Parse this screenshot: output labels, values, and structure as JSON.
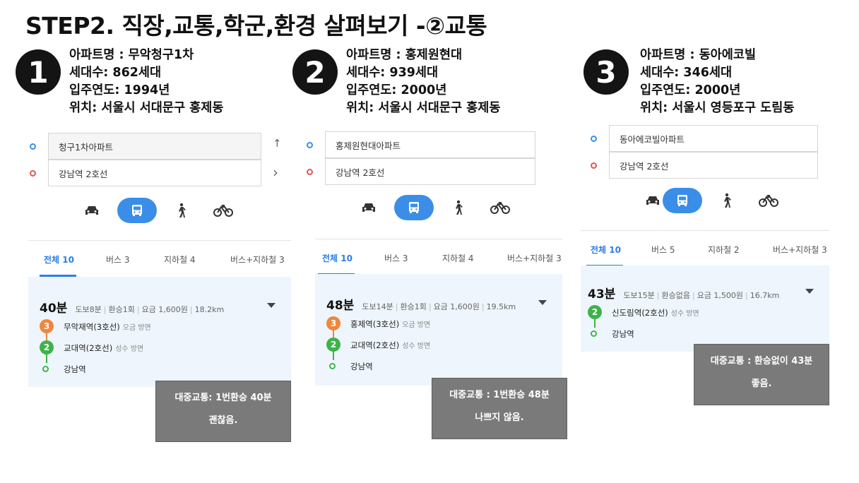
{
  "title": "STEP2. 직장,교통,학군,환경 살펴보기 -②교통",
  "icons": {
    "car": "car-icon",
    "bus": "bus-icon",
    "walk": "walk-icon",
    "bike": "bicycle-icon"
  },
  "colors": {
    "accent": "#3b8ee8",
    "line2": "#3db34a",
    "line3": "#f0873c",
    "note_bg": "#7a7a7a"
  },
  "cards": [
    {
      "number": "1",
      "info": [
        "아파트명 : 무악청구1차",
        "세대수: 862세대",
        "입주연도: 1994년",
        "위치: 서울시 서대문구 홍제동"
      ],
      "start": "청구1차아파트",
      "end": "강남역 2호선",
      "side_top": "↑",
      "side_bottom": "›",
      "tabs": [
        "전체 10",
        "버스 3",
        "지하철 4",
        "버스+지하철 3"
      ],
      "time": "40분",
      "meta": [
        "도보8분",
        "환승1회",
        "요금 1,600원",
        "18.2km"
      ],
      "stops": [
        {
          "line": "3",
          "name": "무악재역(3호선)",
          "dir": "오금 방면"
        },
        {
          "line": "2",
          "name": "교대역(2호선)",
          "dir": "성수 방면"
        }
      ],
      "destination": "강남역",
      "note": [
        "대중교통: 1번환승 40분",
        "괜찮음."
      ]
    },
    {
      "number": "2",
      "info": [
        "아파트명 : 홍제원현대",
        "세대수: 939세대",
        "입주연도: 2000년",
        "위치: 서울시 서대문구 홍제동"
      ],
      "start": "홍제원현대아파트",
      "end": "강남역 2호선",
      "tabs": [
        "전체 10",
        "버스 3",
        "지하철 4",
        "버스+지하철 3"
      ],
      "time": "48분",
      "meta": [
        "도보14분",
        "환승1회",
        "요금 1,600원",
        "19.5km"
      ],
      "stops": [
        {
          "line": "3",
          "name": "홍제역(3호선)",
          "dir": "오금 방면"
        },
        {
          "line": "2",
          "name": "교대역(2호선)",
          "dir": "성수 방면"
        }
      ],
      "destination": "강남역",
      "note": [
        "대중교통 : 1번환승 48분",
        "나쁘지 않음."
      ]
    },
    {
      "number": "3",
      "info": [
        "아파트명 : 동아에코빌",
        "세대수: 346세대",
        "입주연도: 2000년",
        "위치: 서울시 영등포구 도림동"
      ],
      "start": "동아에코빌아파트",
      "end": "강남역 2호선",
      "tabs": [
        "전체 10",
        "버스 5",
        "지하철 2",
        "버스+지하철 3"
      ],
      "time": "43분",
      "meta": [
        "도보15분",
        "환승없음",
        "요금 1,500원",
        "16.7km"
      ],
      "stops": [
        {
          "line": "2",
          "name": "신도림역(2호선)",
          "dir": "성수 방면"
        }
      ],
      "destination": "강남역",
      "note": [
        "대중교통 : 환승없이 43분",
        "좋음."
      ]
    }
  ]
}
